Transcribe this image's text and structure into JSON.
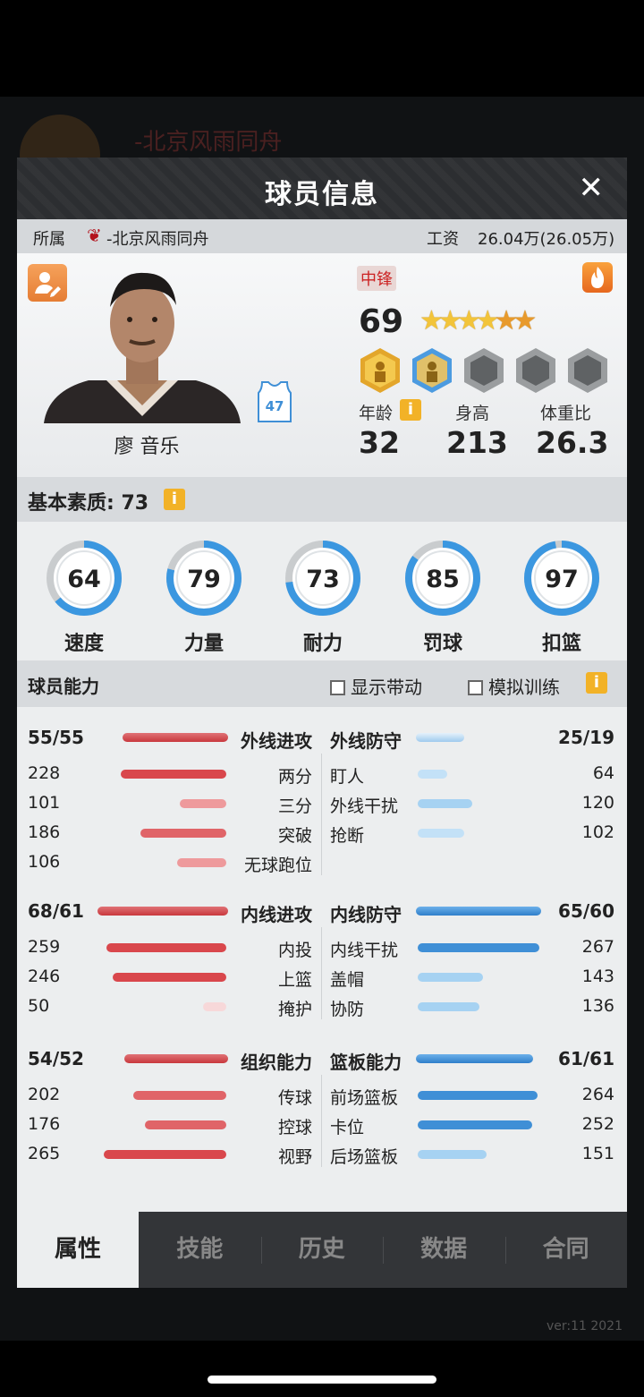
{
  "background": {
    "team_name": "-北京风雨同舟",
    "version": "ver:11  2021"
  },
  "header": {
    "title": "球员信息"
  },
  "affiliation": {
    "label": "所属",
    "team": "-北京风雨同舟",
    "salary_label": "工资",
    "salary_value": "26.04万(26.05万)"
  },
  "player": {
    "name": "廖 音乐",
    "position": "中锋",
    "overall": "69",
    "jersey_number": "47",
    "stars_total": 6,
    "age_label": "年龄",
    "age": "32",
    "height_label": "身高",
    "height": "213",
    "weight_label": "体重比",
    "weight": "26.3",
    "badges": [
      "gold-badge",
      "blue-badge",
      "locked",
      "locked",
      "locked"
    ]
  },
  "basic": {
    "title": "基本素质: 73",
    "attributes": [
      {
        "label": "速度",
        "value": "64"
      },
      {
        "label": "力量",
        "value": "79"
      },
      {
        "label": "耐力",
        "value": "73"
      },
      {
        "label": "罚球",
        "value": "85"
      },
      {
        "label": "扣篮",
        "value": "97"
      }
    ]
  },
  "ability": {
    "title": "球员能力",
    "show_drive": "显示带动",
    "sim_training": "模拟训练",
    "groups": [
      {
        "left": {
          "name": "外线进攻",
          "value": "55/55",
          "rows": [
            {
              "label": "两分",
              "value": "228"
            },
            {
              "label": "三分",
              "value": "101"
            },
            {
              "label": "突破",
              "value": "186"
            },
            {
              "label": "无球跑位",
              "value": "106"
            }
          ]
        },
        "right": {
          "name": "外线防守",
          "value": "25/19",
          "rows": [
            {
              "label": "盯人",
              "value": "64"
            },
            {
              "label": "外线干扰",
              "value": "120"
            },
            {
              "label": "抢断",
              "value": "102"
            }
          ]
        }
      },
      {
        "left": {
          "name": "内线进攻",
          "value": "68/61",
          "rows": [
            {
              "label": "内投",
              "value": "259"
            },
            {
              "label": "上篮",
              "value": "246"
            },
            {
              "label": "掩护",
              "value": "50"
            }
          ]
        },
        "right": {
          "name": "内线防守",
          "value": "65/60",
          "rows": [
            {
              "label": "内线干扰",
              "value": "267"
            },
            {
              "label": "盖帽",
              "value": "143"
            },
            {
              "label": "协防",
              "value": "136"
            }
          ]
        }
      },
      {
        "left": {
          "name": "组织能力",
          "value": "54/52",
          "rows": [
            {
              "label": "传球",
              "value": "202"
            },
            {
              "label": "控球",
              "value": "176"
            },
            {
              "label": "视野",
              "value": "265"
            }
          ]
        },
        "right": {
          "name": "篮板能力",
          "value": "61/61",
          "rows": [
            {
              "label": "前场篮板",
              "value": "264"
            },
            {
              "label": "卡位",
              "value": "252"
            },
            {
              "label": "后场篮板",
              "value": "151"
            }
          ]
        }
      }
    ]
  },
  "tabs": [
    "属性",
    "技能",
    "历史",
    "数据",
    "合同"
  ],
  "active_tab": 0,
  "colors": {
    "attack": "#d9474c",
    "defense": "#3f8fd6",
    "gauge": "#3b97e0"
  }
}
